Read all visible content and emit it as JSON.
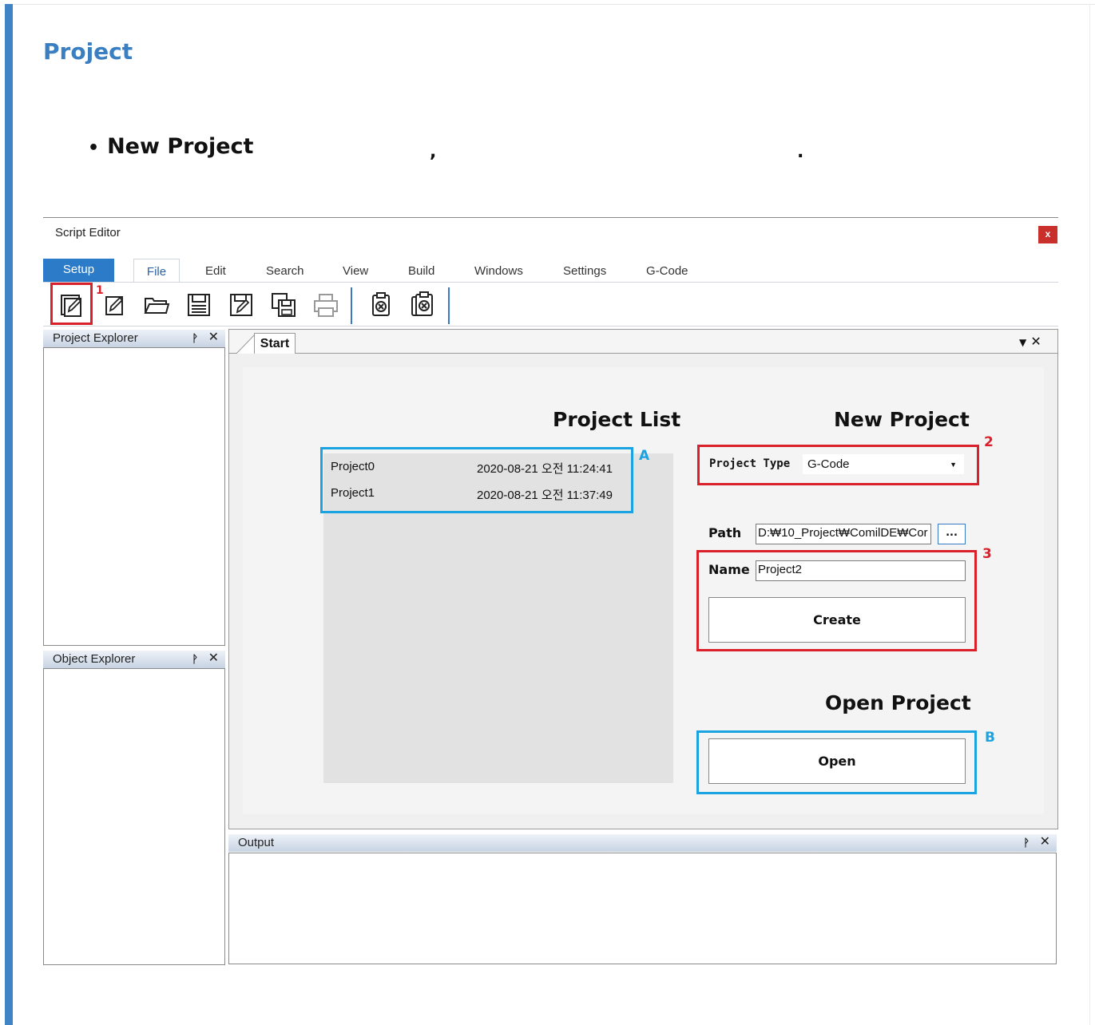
{
  "doc": {
    "title": "Project",
    "bullet_text": "New Project",
    "comma": ",",
    "period": "."
  },
  "window": {
    "title": "Script Editor",
    "close_label": "x"
  },
  "menu": {
    "items": [
      "Setup",
      "File",
      "Edit",
      "Search",
      "View",
      "Build",
      "Windows",
      "Settings",
      "G-Code"
    ]
  },
  "toolbar": {
    "icons": [
      "new-project-icon",
      "new-file-icon",
      "open-folder-icon",
      "save-icon",
      "save-as-icon",
      "save-all-icon",
      "print-icon",
      "close-file-icon",
      "close-all-icon"
    ]
  },
  "panels": {
    "project_explorer": "Project Explorer",
    "object_explorer": "Object Explorer",
    "output": "Output",
    "pin_glyph": "Ԅ",
    "close_glyph": "✕"
  },
  "start": {
    "tab_label": "Start",
    "project_list_title": "Project List",
    "projects": [
      {
        "name": "Project0",
        "date": "2020-08-21 오전 11:24:41"
      },
      {
        "name": "Project1",
        "date": "2020-08-21 오전 11:37:49"
      }
    ],
    "new_project_title": "New Project",
    "project_type_label": "Project Type",
    "project_type_value": "G-Code",
    "path_label": "Path",
    "path_value": "D:₩10_Project₩ComilDE₩Cor",
    "browse_label": "...",
    "name_label": "Name",
    "name_value": "Project2",
    "create_label": "Create",
    "open_project_title": "Open Project",
    "open_label": "Open"
  },
  "annotations": {
    "marker_1": "1",
    "marker_2": "2",
    "marker_3": "3",
    "marker_a": "A",
    "marker_b": "B",
    "red": "#d9202b",
    "blue": "#1aa3e0"
  }
}
